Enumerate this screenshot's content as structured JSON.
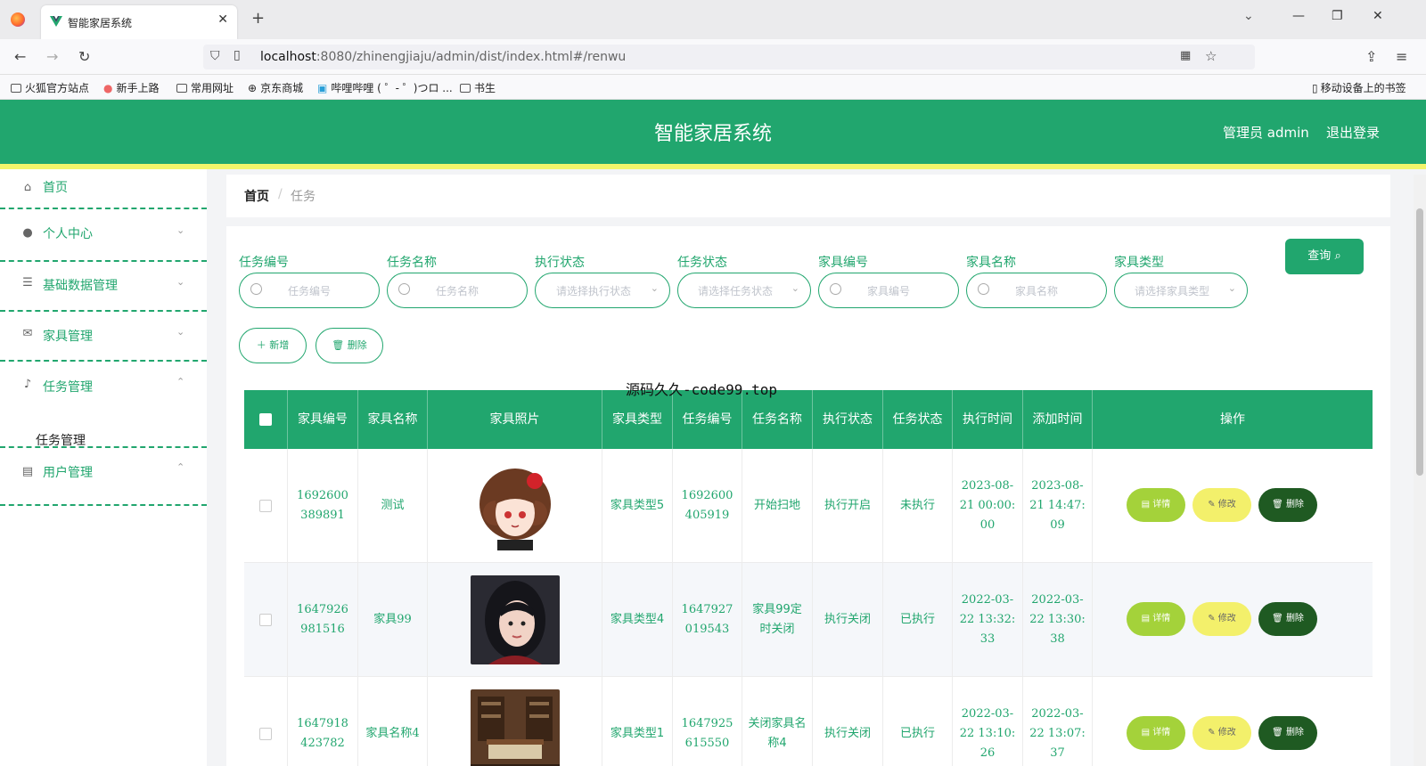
{
  "browser": {
    "tab_title": "智能家居系统",
    "url_host": "localhost",
    "url_rest": ":8080/zhinengjiaju/admin/dist/index.html#/renwu",
    "bookmarks": [
      "火狐官方站点",
      "新手上路",
      "常用网址",
      "京东商城",
      "哔哩哔哩 ( ゜- ゜)つロ ...",
      "书生"
    ],
    "mobile_bookmarks": "移动设备上的书签"
  },
  "header": {
    "title": "智能家居系统",
    "admin": "管理员 admin",
    "logout": "退出登录"
  },
  "sidebar": {
    "items": [
      {
        "label": "首页",
        "icon": "home-icon"
      },
      {
        "label": "个人中心",
        "icon": "user-icon"
      },
      {
        "label": "基础数据管理",
        "icon": "sliders-icon"
      },
      {
        "label": "家具管理",
        "icon": "mail-icon"
      },
      {
        "label": "任务管理",
        "icon": "mic-icon"
      },
      {
        "label": "用户管理",
        "icon": "id-card-icon"
      }
    ],
    "sub_item": "任务管理"
  },
  "breadcrumb": {
    "home": "首页",
    "sep": "/",
    "current": "任务"
  },
  "filters": [
    {
      "label": "任务编号",
      "placeholder": "任务编号",
      "type": "search"
    },
    {
      "label": "任务名称",
      "placeholder": "任务名称",
      "type": "search"
    },
    {
      "label": "执行状态",
      "placeholder": "请选择执行状态",
      "type": "select"
    },
    {
      "label": "任务状态",
      "placeholder": "请选择任务状态",
      "type": "select"
    },
    {
      "label": "家具编号",
      "placeholder": "家具编号",
      "type": "search"
    },
    {
      "label": "家具名称",
      "placeholder": "家具名称",
      "type": "search"
    },
    {
      "label": "家具类型",
      "placeholder": "请选择家具类型",
      "type": "select"
    }
  ],
  "buttons": {
    "query": "查询",
    "add": "新增",
    "delete": "删除"
  },
  "table": {
    "headers": [
      "家具编号",
      "家具名称",
      "家具照片",
      "家具类型",
      "任务编号",
      "任务名称",
      "执行状态",
      "任务状态",
      "执行时间",
      "添加时间",
      "操作"
    ],
    "rows": [
      {
        "furniture_no": "1692600389891",
        "furniture_name": "测试",
        "furniture_type": "家具类型5",
        "task_no": "1692600405919",
        "task_name": "开始扫地",
        "exec_status": "执行开启",
        "task_status": "未执行",
        "exec_time": "2023-08-21 00:00:00",
        "add_time": "2023-08-21 14:47:09"
      },
      {
        "furniture_no": "1647926981516",
        "furniture_name": "家具99",
        "furniture_type": "家具类型4",
        "task_no": "1647927019543",
        "task_name": "家具99定时关闭",
        "exec_status": "执行关闭",
        "task_status": "已执行",
        "exec_time": "2022-03-22 13:32:33",
        "add_time": "2022-03-22 13:30:38"
      },
      {
        "furniture_no": "1647918423782",
        "furniture_name": "家具名称4",
        "furniture_type": "家具类型1",
        "task_no": "1647925615550",
        "task_name": "关闭家具名称4",
        "exec_status": "执行关闭",
        "task_status": "已执行",
        "exec_time": "2022-03-22 13:10:26",
        "add_time": "2022-03-22 13:07:37"
      }
    ],
    "ops": {
      "detail": "详情",
      "edit": "修改",
      "delete": "删除"
    }
  },
  "overlay_text": "源码久久-code99.top",
  "colors": {
    "primary": "#21a66e",
    "accent_yellow": "#f2f46b",
    "detail": "#a4d23a",
    "edit": "#f3f06b",
    "delete": "#1f5a22"
  }
}
